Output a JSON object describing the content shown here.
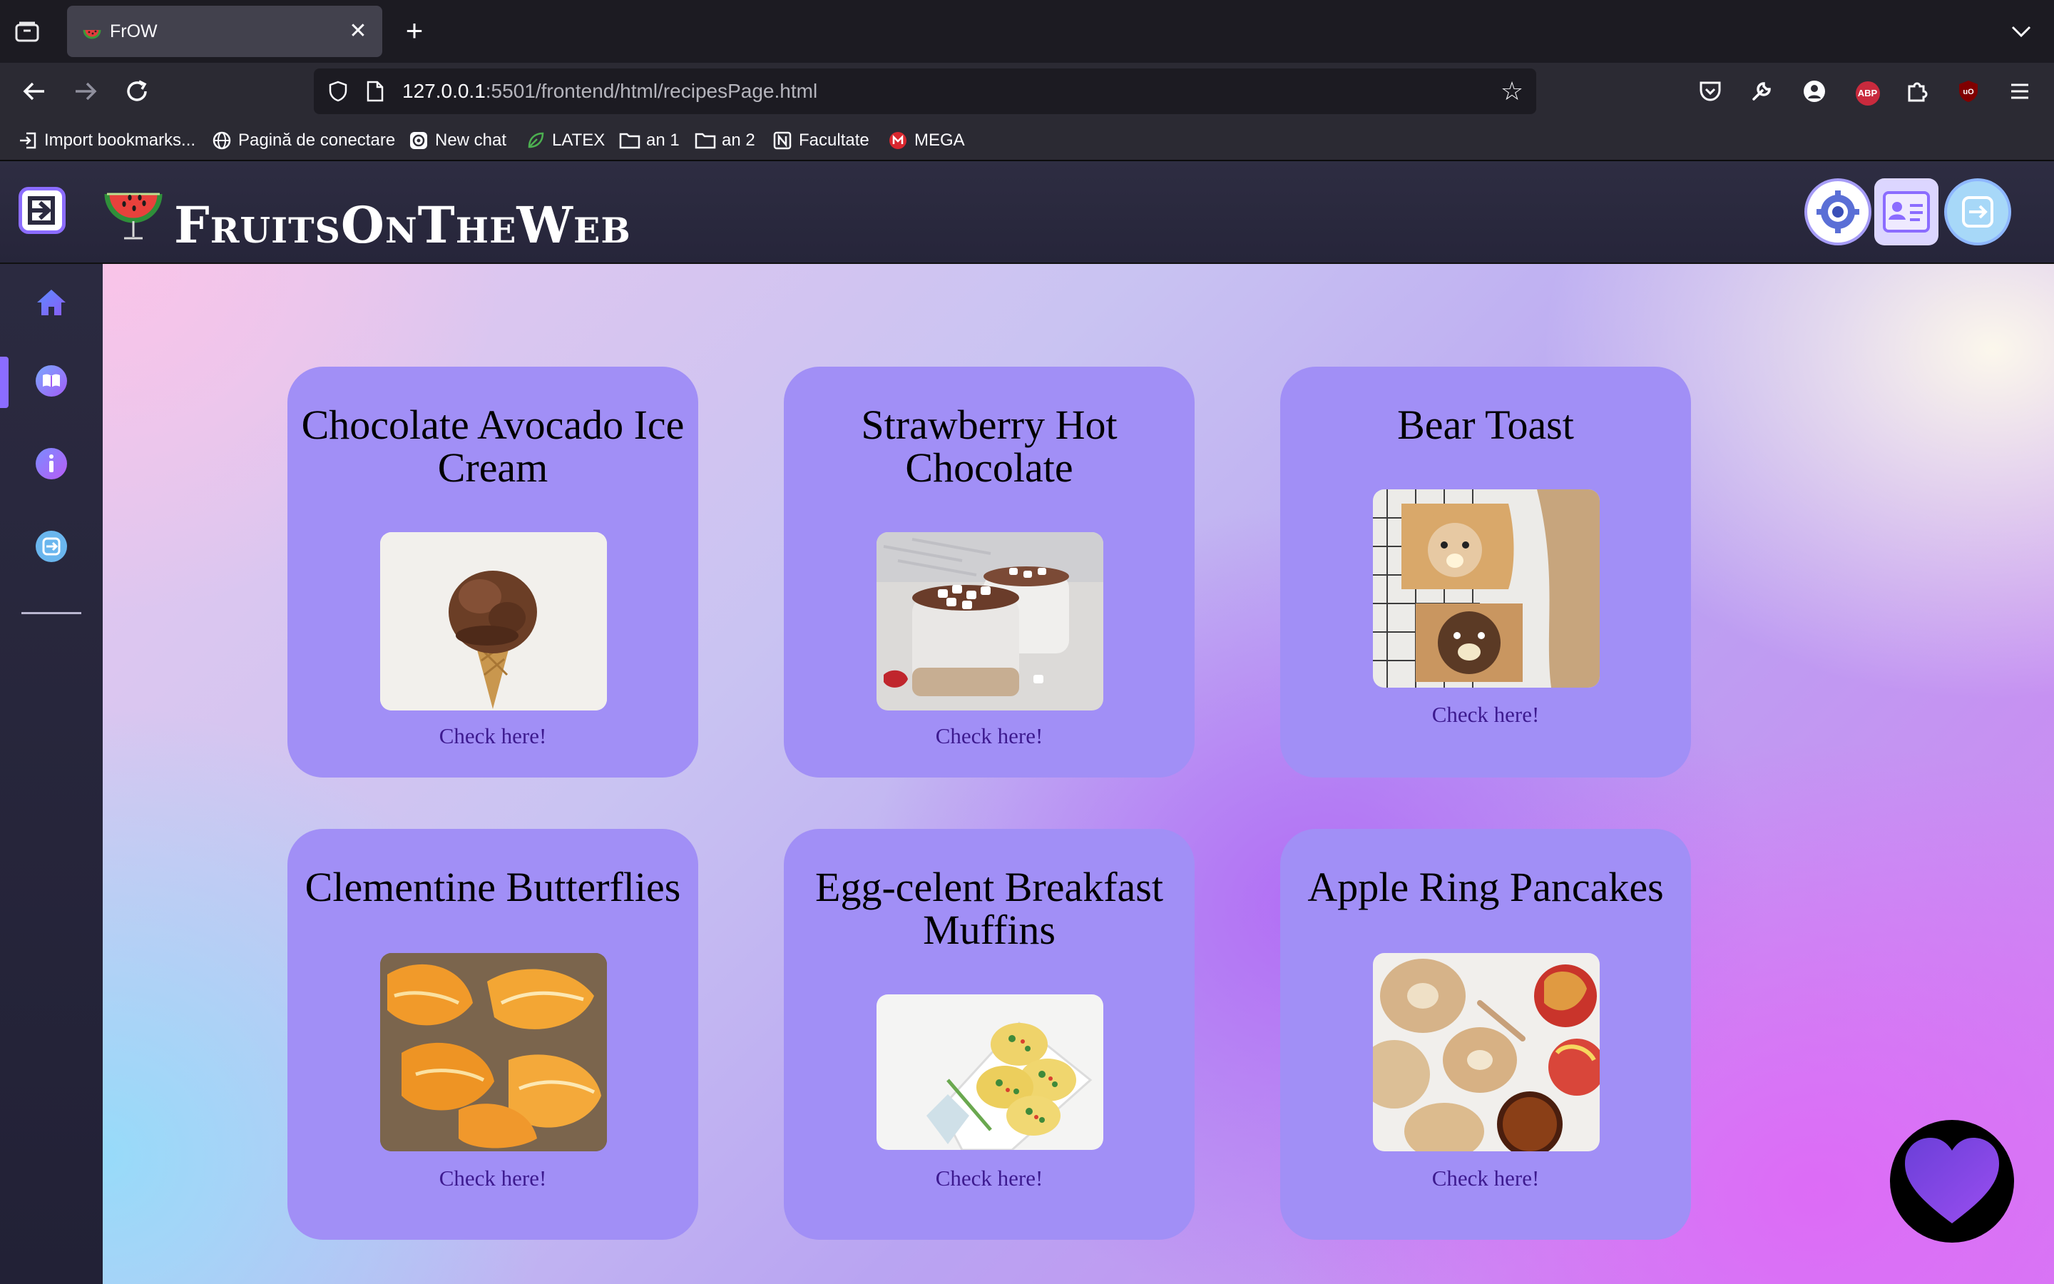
{
  "browser": {
    "tab": {
      "title": "FrOW"
    },
    "url": {
      "host": "127.0.0.1",
      "rest": ":5501/frontend/html/recipesPage.html"
    },
    "bookmarks": [
      {
        "label": "Import bookmarks...",
        "icon": "import-icon"
      },
      {
        "label": "Pagină de conectare",
        "icon": "globe-icon"
      },
      {
        "label": "New chat",
        "icon": "chatgpt-icon"
      },
      {
        "label": "LATEX",
        "icon": "leaf-icon"
      },
      {
        "label": "an 1",
        "icon": "folder-icon"
      },
      {
        "label": "an 2",
        "icon": "folder-icon"
      },
      {
        "label": "Facultate",
        "icon": "notion-icon"
      },
      {
        "label": "MEGA",
        "icon": "mega-icon"
      }
    ]
  },
  "site": {
    "brand": "FruitsOnTheWeb",
    "sidebar": [
      {
        "icon": "home-icon"
      },
      {
        "icon": "recipes-book-icon",
        "active": true
      },
      {
        "icon": "info-icon"
      },
      {
        "icon": "logout-icon"
      }
    ]
  },
  "recipes": [
    {
      "title": "Chocolate Avocado Ice Cream",
      "link": "Check here!",
      "image": "chocolate ice cream cone"
    },
    {
      "title": "Strawberry Hot Chocolate",
      "link": "Check here!",
      "image": "mugs of hot chocolate with marshmallows"
    },
    {
      "title": "Bear Toast",
      "link": "Check here!",
      "image": "bear faced toast"
    },
    {
      "title": "Clementine Butterflies",
      "link": "Check here!",
      "image": "clementine peels"
    },
    {
      "title": "Egg-celent Breakfast Muffins",
      "link": "Check here!",
      "image": "egg muffins"
    },
    {
      "title": "Apple Ring Pancakes",
      "link": "Check here!",
      "image": "apple ring pancakes"
    }
  ],
  "colors": {
    "card": "#a18ff6",
    "accent": "#8b6cff",
    "link": "#3d1a8f"
  }
}
